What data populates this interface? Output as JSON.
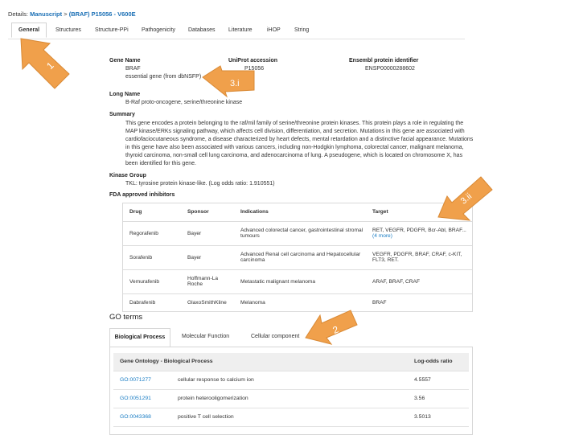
{
  "breadcrumb": {
    "prefix": "Details:",
    "item1": "Manuscript",
    "sep": ">",
    "item2": "(BRAF) P15056 - V600E"
  },
  "tabs": [
    "General",
    "Structures",
    "Structure-PPi",
    "Pathogenicity",
    "Databases",
    "Literature",
    "iHOP",
    "String"
  ],
  "gene": {
    "name_label": "Gene Name",
    "name_value": "BRAF",
    "essential": "essential gene (from dbNSFP)",
    "uniprot_label": "UniProt accession",
    "uniprot_value": "P15056",
    "ensembl_label": "Ensembl protein identifier",
    "ensembl_value": "ENSP00000288602",
    "longname_label": "Long Name",
    "longname_value": "B-Raf proto-oncogene, serine/threonine kinase",
    "summary_label": "Summary",
    "summary_value": "This gene encodes a protein belonging to the raf/mil family of serine/threonine protein kinases. This protein plays a role in regulating the MAP kinase/ERKs signaling pathway, which affects cell division, differentiation, and secretion. Mutations in this gene are associated with cardiofaciocutaneous syndrome, a disease characterized by heart defects, mental retardation and a distinctive facial appearance. Mutations in this gene have also been associated with various cancers, including non-Hodgkin lymphoma, colorectal cancer, malignant melanoma, thyroid carcinoma, non-small cell lung carcinoma, and adenocarcinoma of lung. A pseudogene, which is located on chromosome X, has been identified for this gene.",
    "kinase_label": "Kinase Group",
    "kinase_value": "TKL: tyrosine protein kinase-like. (Log odds ratio: 1.910551)",
    "fda_label": "FDA approved inhibitors"
  },
  "inhibitors": {
    "headers": [
      "Drug",
      "Sponsor",
      "Indications",
      "Target"
    ],
    "rows": [
      {
        "drug": "Regorafenib",
        "sponsor": "Bayer",
        "indications": "Advanced colorectal cancer, gastrointestinal stromal tumours",
        "target": "RET, VEGFR, PDGFR, Bcr-Abl, BRAF...",
        "more": "(4 more)"
      },
      {
        "drug": "Sorafenib",
        "sponsor": "Bayer",
        "indications": "Advanced Renal cell carcinoma and Hepatocellular carcinoma",
        "target": "VEGFR, PDGFR, BRAF, CRAF, c-KIT, FLT3, RET.",
        "more": ""
      },
      {
        "drug": "Vemurafenib",
        "sponsor": "Hoffmann-La Roche",
        "indications": "Metastatic malignant melanoma",
        "target": "ARAF, BRAF, CRAF",
        "more": ""
      },
      {
        "drug": "Dabrafenib",
        "sponsor": "GlaxoSmithKline",
        "indications": "Melanoma",
        "target": "BRAF",
        "more": ""
      }
    ]
  },
  "go": {
    "title": "GO terms",
    "tabs": [
      "Biological Process",
      "Molecular Function",
      "Cellular component"
    ],
    "headers": [
      "Gene Ontology - Biological Process",
      "Log-odds ratio"
    ],
    "rows": [
      {
        "id": "GO:0071277",
        "term": "cellular response to calcium ion",
        "ratio": "4.5557"
      },
      {
        "id": "GO:0051291",
        "term": "protein heterooligomerization",
        "ratio": "3.56"
      },
      {
        "id": "GO:0043368",
        "term": "positive T cell selection",
        "ratio": "3.5013"
      }
    ]
  },
  "annotations": {
    "a1": "1",
    "a2": "2",
    "a3i": "3.i",
    "a3ii": "3.ii",
    "arrow_color": "#f0a04b"
  }
}
